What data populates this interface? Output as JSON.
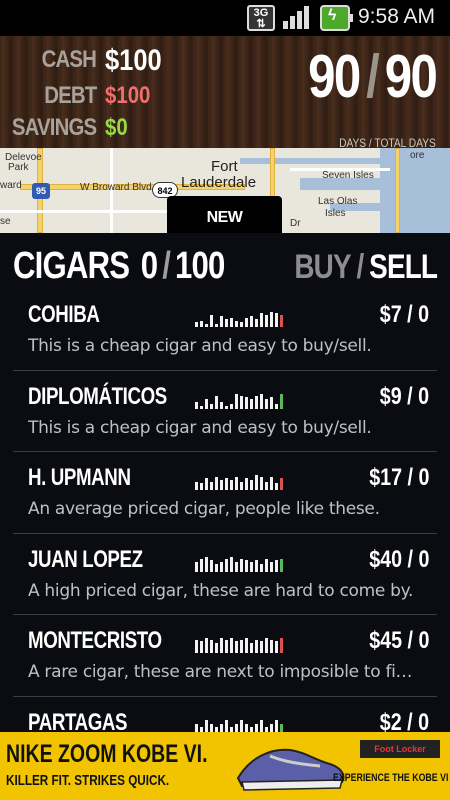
{
  "status_bar": {
    "network": "3G",
    "time": "9:58 AM",
    "icons": [
      "network-3g-icon",
      "signal-icon",
      "battery-charging-icon"
    ]
  },
  "stats": {
    "cash_label": "CASH",
    "cash_value": "$100",
    "debt_label": "DEBT",
    "debt_value": "$100",
    "savings_label": "SAVINGS",
    "savings_value": "$0",
    "days": "90",
    "total_days": "90",
    "days_caption": "DAYS / TOTAL DAYS",
    "colors": {
      "debt": "#ee6f6f",
      "savings": "#98d84a"
    }
  },
  "map": {
    "labels": [
      "Fort",
      "Lauderdale",
      "Delevoe",
      "Park",
      "ward",
      "se",
      "W Broward Blvd",
      "Seven Isles",
      "Las Olas",
      "Isles",
      "ore",
      "Dr"
    ],
    "route_shields": [
      "95",
      "842"
    ],
    "new_location_button": "NEW LOCATION"
  },
  "title": {
    "heading": "CIGARS",
    "owned": "0",
    "capacity": "100",
    "buy_label": "BUY",
    "sell_label": "SELL"
  },
  "items": [
    {
      "name": "COHIBA",
      "price": "$7 / 0",
      "description": "This is a cheap cigar and easy to buy/sell.",
      "trend": [
        3,
        4,
        2,
        8,
        2,
        7,
        5,
        6,
        4,
        3,
        6,
        7,
        5,
        9,
        8,
        10,
        9,
        8
      ],
      "trend_end_color": "#d9534f"
    },
    {
      "name": "DIPLOMÁTICOS",
      "price": "$9 / 0",
      "description": "This is a cheap cigar and easy to buy/sell.",
      "trend": [
        4,
        2,
        6,
        3,
        8,
        4,
        2,
        3,
        9,
        8,
        7,
        6,
        8,
        9,
        6,
        7,
        3,
        9
      ],
      "trend_end_color": "#5cb85c"
    },
    {
      "name": "H. UPMANN",
      "price": "$17 / 0",
      "description": "An average priced cigar, people like these.",
      "trend": [
        5,
        4,
        7,
        5,
        8,
        6,
        7,
        6,
        8,
        5,
        7,
        6,
        9,
        8,
        5,
        8,
        4,
        7
      ],
      "trend_end_color": "#d9534f"
    },
    {
      "name": "JUAN LOPEZ",
      "price": "$40 / 0",
      "description": "A high priced cigar, these are hard to come by.",
      "trend": [
        6,
        8,
        9,
        7,
        5,
        6,
        8,
        9,
        6,
        8,
        7,
        6,
        7,
        5,
        8,
        6,
        7,
        8
      ],
      "trend_end_color": "#5cb85c"
    },
    {
      "name": "MONTECRISTO",
      "price": "$45 / 0",
      "description": "A rare cigar, these are next to imposible to fi…",
      "trend": [
        8,
        7,
        9,
        8,
        6,
        9,
        8,
        9,
        7,
        8,
        9,
        6,
        8,
        7,
        9,
        8,
        7,
        9
      ],
      "trend_end_color": "#d9534f"
    },
    {
      "name": "PARTAGAS",
      "price": "$2 / 0",
      "description": "",
      "trend": [
        3,
        2,
        4,
        3,
        2,
        3,
        4,
        2,
        3,
        4,
        3,
        2,
        3,
        4,
        2,
        3,
        4,
        3
      ],
      "trend_end_color": "#5cb85c"
    }
  ],
  "ad": {
    "headline": "NIKE ZOOM KOBE VI.",
    "tagline": "KILLER FIT. STRIKES QUICK.",
    "brand": "Foot Locker",
    "cta": "EXPERIENCE THE KOBE VI"
  }
}
